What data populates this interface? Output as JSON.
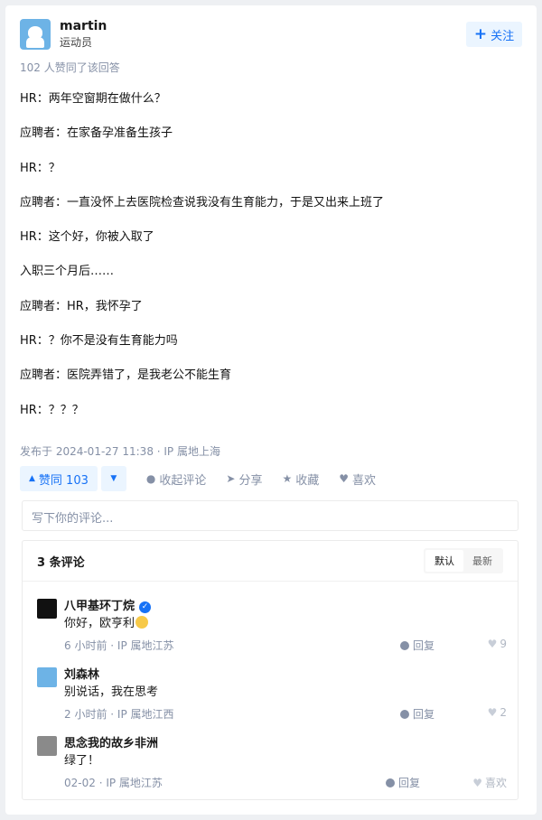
{
  "author": {
    "name": "martin",
    "bio": "运动员",
    "follow_label": "关注",
    "follow_icon": "plus-icon"
  },
  "approve_text": "102 人赞同了该回答",
  "answer_lines": [
    "HR：两年空窗期在做什么？",
    "应聘者：在家备孕准备生孩子",
    "HR：？",
    "应聘者：一直没怀上去医院检查说我没有生育能力，于是又出来上班了",
    "HR：这个好，你被入取了",
    "入职三个月后……",
    "应聘者：HR，我怀孕了",
    "HR：？你不是没有生育能力吗",
    "应聘者：医院弄错了，是我老公不能生育",
    "HR：？？？"
  ],
  "publish_info": "发布于 2024-01-27 11:38 · IP 属地上海",
  "actions": {
    "vote_up": "赞同 103",
    "collapse_comments": "收起评论",
    "share": "分享",
    "favorite": "收藏",
    "like": "喜欢"
  },
  "comment_placeholder": "写下你的评论...",
  "comments_section": {
    "count_label": "3 条评论",
    "sort_default": "默认",
    "sort_latest": "最新",
    "items": [
      {
        "name": "八甲基环丁烷",
        "text": "你好，欧亨利",
        "time": "6 小时前",
        "ip": "IP 属地江苏",
        "reply": "回复",
        "likes": "9",
        "verified": true
      },
      {
        "name": "刘森林",
        "text": "别说话，我在思考",
        "time": "2 小时前",
        "ip": "IP 属地江西",
        "reply": "回复",
        "likes": "2"
      },
      {
        "name": "思念我的故乡非洲",
        "text": "绿了！",
        "time": "02-02",
        "ip": "IP 属地江苏",
        "reply": "回复",
        "likes": "喜欢"
      }
    ]
  },
  "colors": {
    "accent": "#1772f6",
    "accent_bg": "#ebf5ff",
    "muted": "#8590a6"
  }
}
